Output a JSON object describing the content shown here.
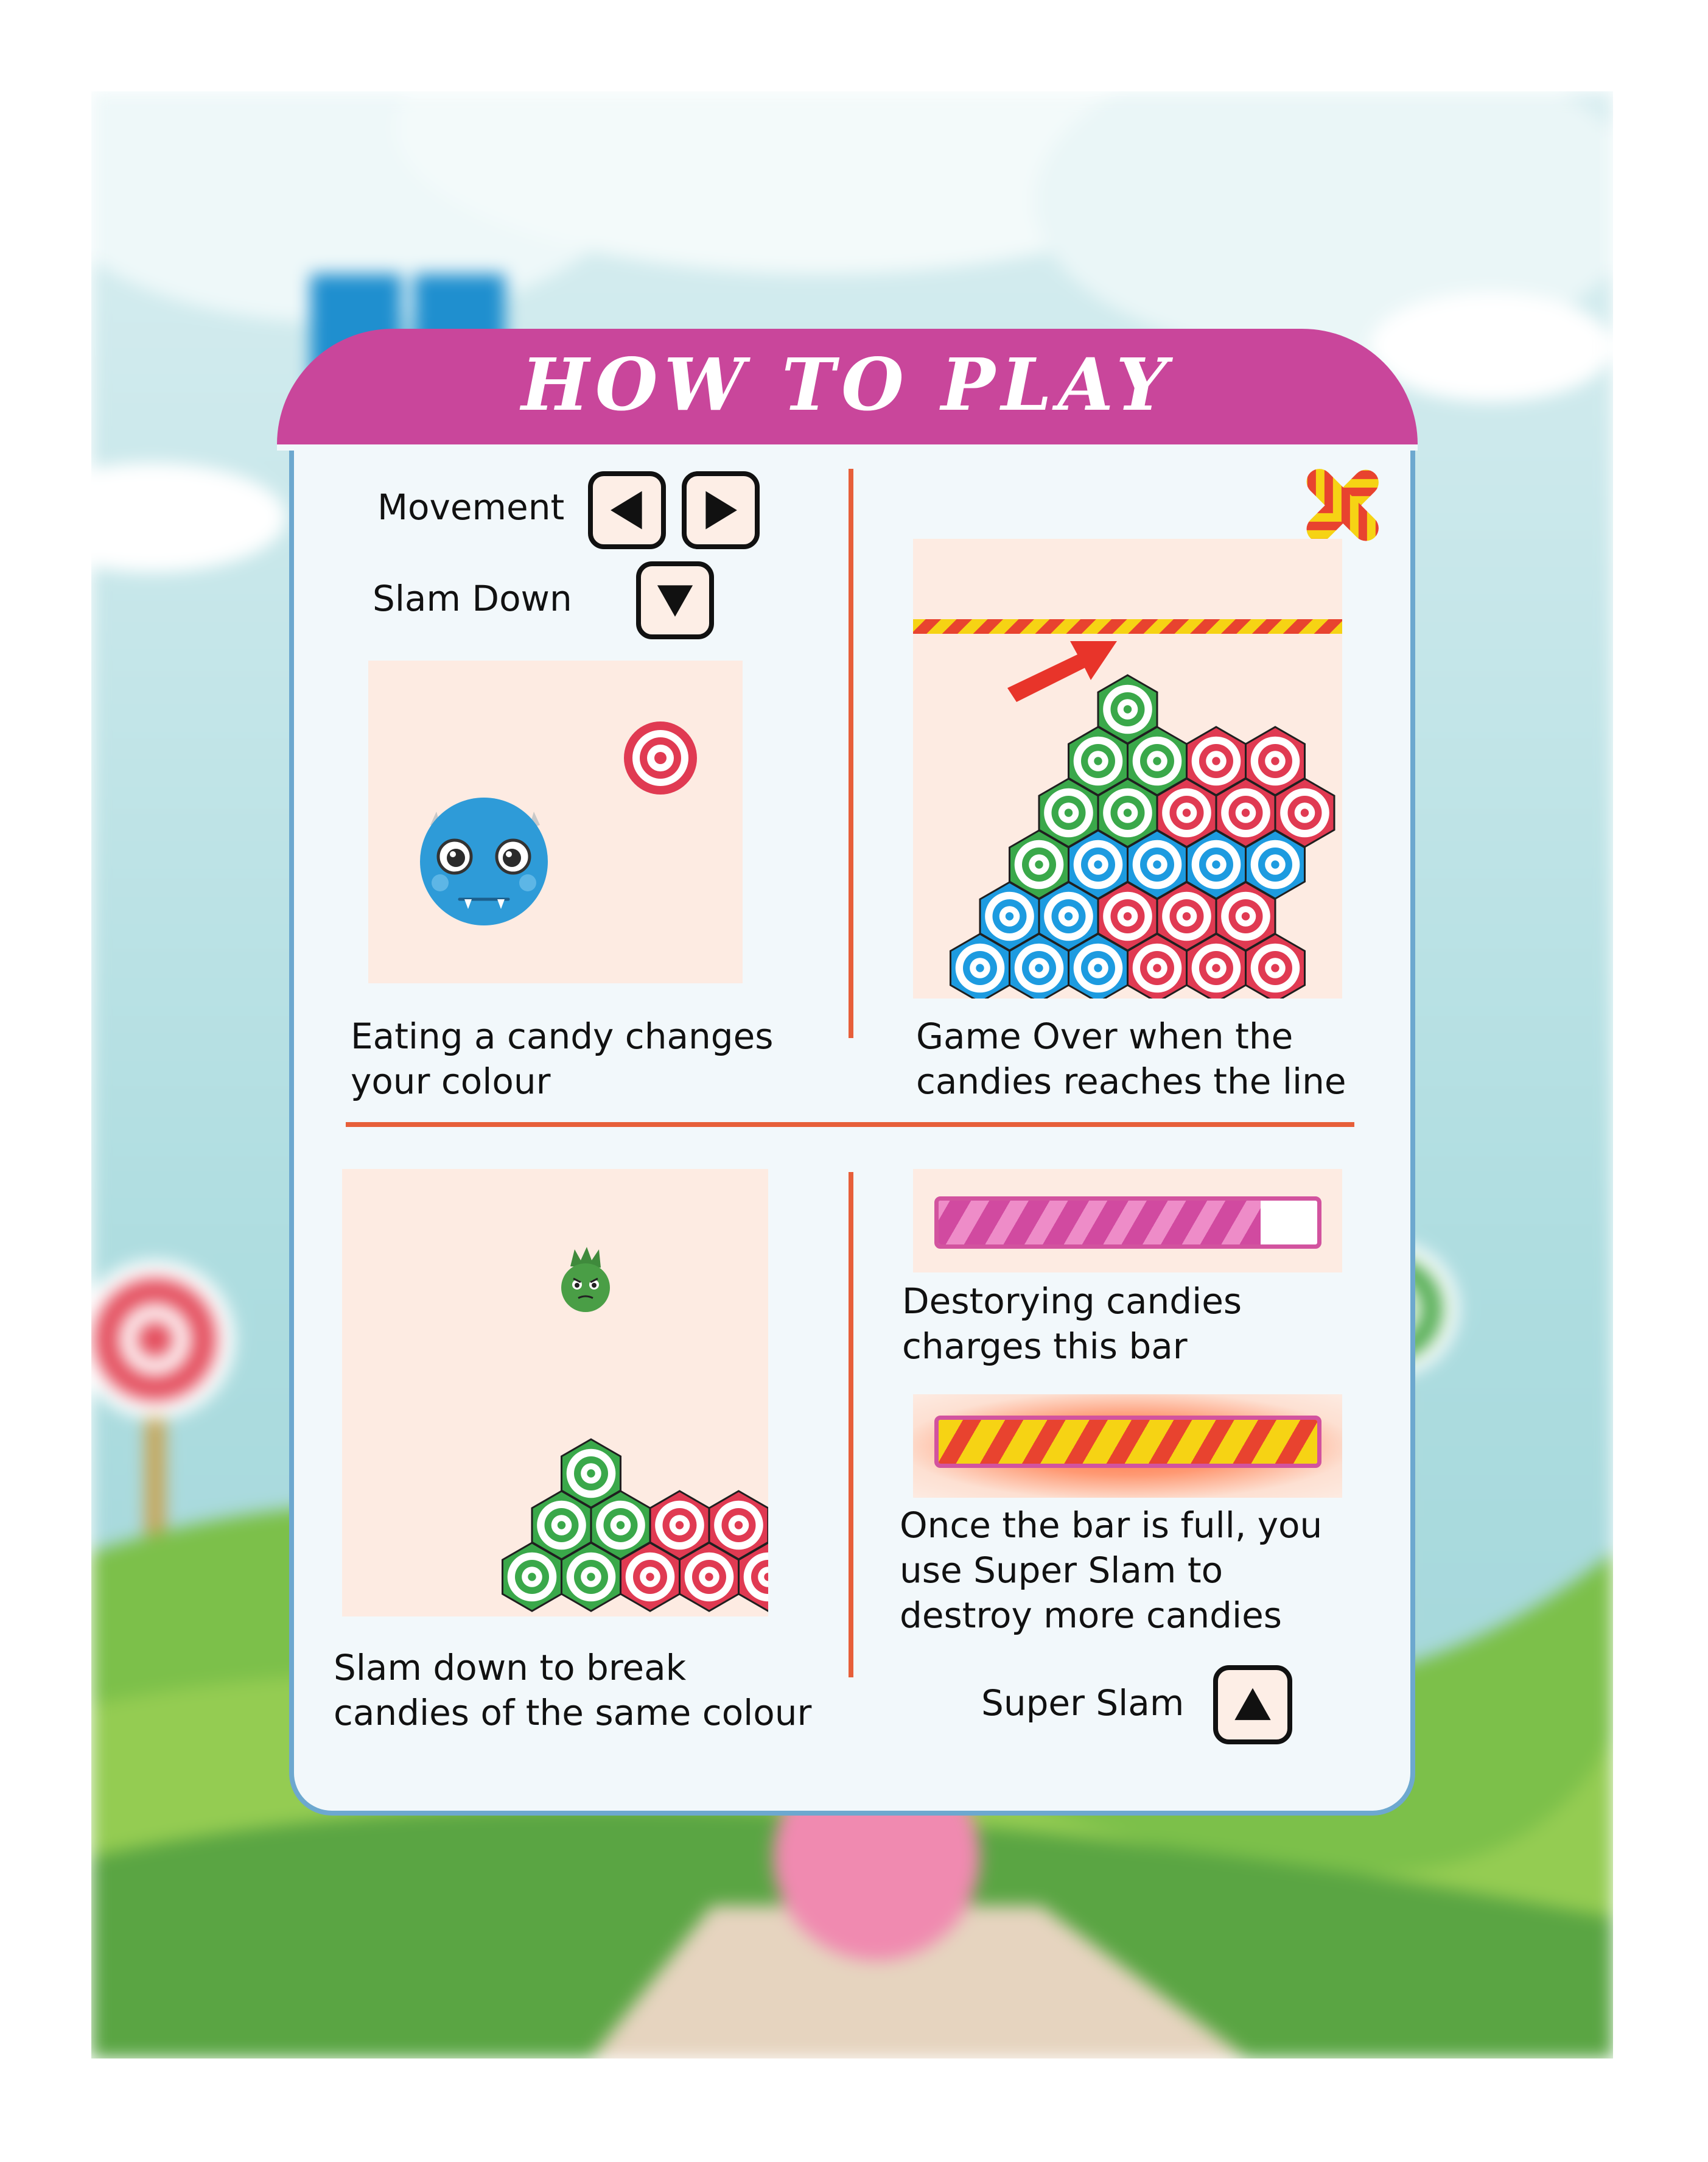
{
  "title": "HOW TO PLAY",
  "controls": {
    "movement_label": "Movement",
    "slam_down_label": "Slam Down",
    "super_slam_label": "Super Slam"
  },
  "tips": {
    "eat_candy": "Eating a candy changes your colour",
    "game_over": "Game Over when the candies reaches the line",
    "slam_break": "Slam down to break candies of the same colour",
    "charge_bar": "Destorying candies charges this bar",
    "super_slam": "Once the bar is full, you use Super Slam to destroy more candies"
  },
  "charge_bar": {
    "fill_fraction": 0.85
  },
  "super_bar": {
    "fill_fraction": 1.0
  },
  "colors": {
    "header": "#c9469b",
    "panel_border": "#6da8cf",
    "divider": "#e75f3a",
    "candy_green": "#3aa84a",
    "candy_red": "#e03a52",
    "candy_blue": "#1d9be0",
    "monster_blue": "#2e9bd8"
  },
  "icons": {
    "left": "left-arrow-icon",
    "right": "right-arrow-icon",
    "down": "down-arrow-icon",
    "up": "up-arrow-icon",
    "close": "close-icon"
  }
}
